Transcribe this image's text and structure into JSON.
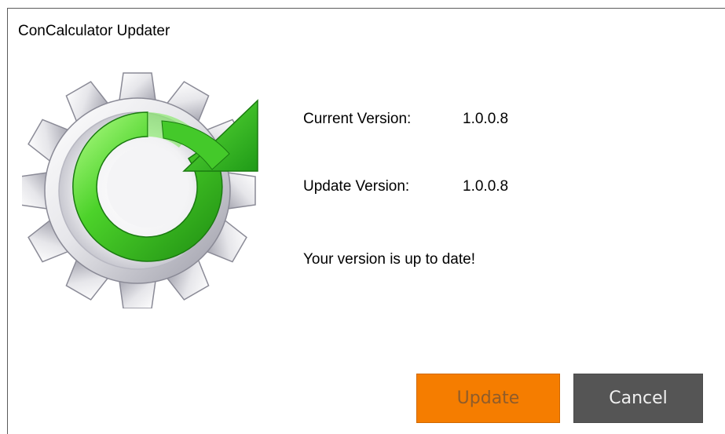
{
  "window": {
    "title": "ConCalculator Updater"
  },
  "icon": {
    "name": "update-gear-icon"
  },
  "versions": {
    "current_label": "Current Version:",
    "current_value": "1.0.0.8",
    "update_label": "Update Version:",
    "update_value": "1.0.0.8"
  },
  "status": {
    "message": "Your version is up to date!"
  },
  "buttons": {
    "update_label": "Update",
    "cancel_label": "Cancel"
  },
  "colors": {
    "update_button": "#f57d00",
    "cancel_button": "#555555",
    "arrow_green": "#3fbf28"
  }
}
